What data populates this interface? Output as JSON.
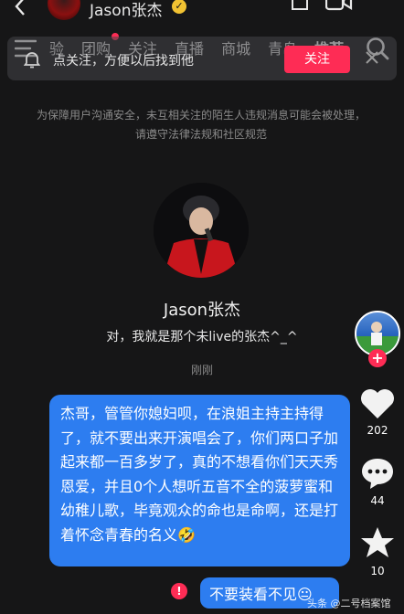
{
  "chat_header": {
    "name": "Jason张杰",
    "verified_icon": "verified-badge-icon"
  },
  "nav": {
    "tabs": [
      {
        "label": "验"
      },
      {
        "label": "团购"
      },
      {
        "label": "关注"
      },
      {
        "label": "直播"
      },
      {
        "label": "商城"
      },
      {
        "label": "青岛"
      },
      {
        "label": "推荐"
      }
    ],
    "active_tab": "推荐",
    "accent_color": "#fe2c55"
  },
  "follow_prompt": {
    "text": "点关注，方便以后找到他",
    "button_label": "关注"
  },
  "safety_notice": "为保障用户沟通安全，未互相关注的陌生人违规消息可能会被处理，请遵守法律法规和社区规范",
  "profile": {
    "name": "Jason张杰",
    "bio": "对，我就是那个未live的张杰^_^"
  },
  "messages": {
    "time": "刚刚",
    "main_text": "杰哥，管管你媳妇呗，在浪姐主持主持得了，就不要出来开演唱会了，你们两口子加起来都一百多岁了，真的不想看你们天天秀恩爱，并且0个人想听五音不全的菠萝蜜和幼稚儿歌，毕竟观众的命也是命啊，还是打着怀念青春的名义🤣",
    "reply_text": "不要装看不见😐",
    "error_icon": "!",
    "bubble_color": "#2d7df0"
  },
  "rail": {
    "like_count": "202",
    "comment_count": "44",
    "favorite_count": "10"
  },
  "watermark": "头条 @二号档案馆"
}
